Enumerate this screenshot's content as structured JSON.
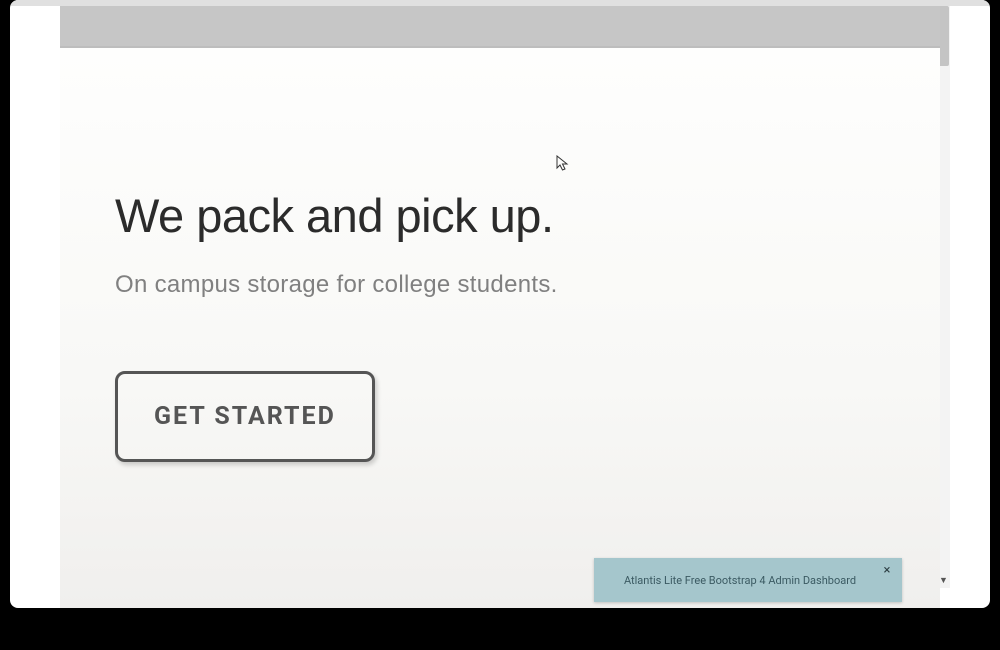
{
  "hero": {
    "title": "We pack and pick up.",
    "subtitle": "On campus storage for college students.",
    "cta_label": "GET STARTED"
  },
  "toast": {
    "message": "Atlantis Lite Free Bootstrap 4 Admin Dashboard",
    "close_symbol": "×"
  }
}
